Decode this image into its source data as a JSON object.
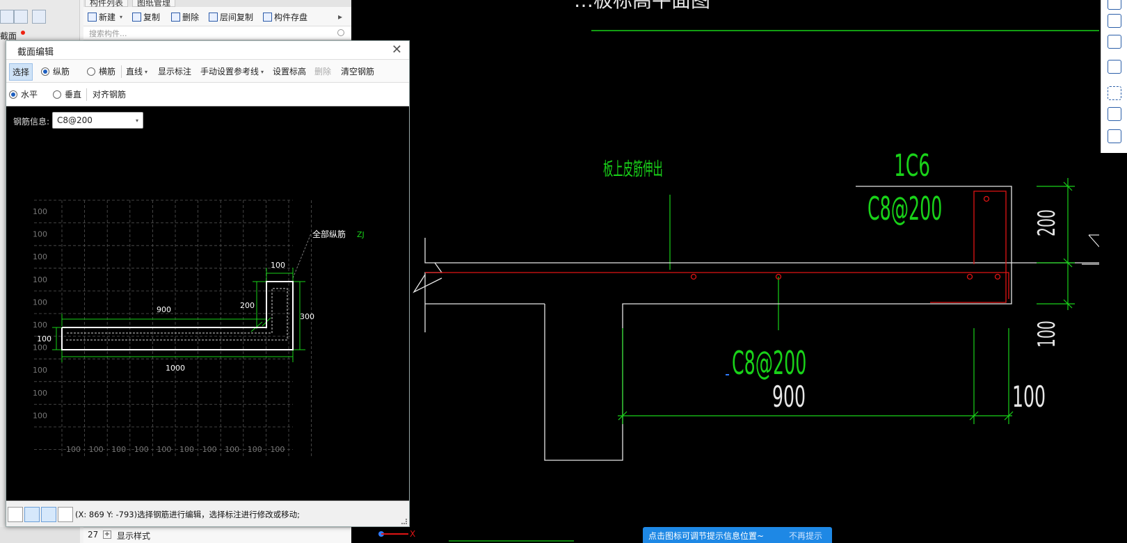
{
  "app": {
    "tabs": [
      "构件列表",
      "图纸管理"
    ],
    "toolbar": {
      "new": "新建",
      "copy": "复制",
      "delete": "删除",
      "floor_copy": "层间复制",
      "save_component": "构件存盘"
    },
    "search_placeholder": "搜索构件...",
    "left_label": "截面",
    "list_row": {
      "num": "27",
      "label": "显示样式"
    }
  },
  "cad": {
    "title_partial": "…板标高平面图",
    "note_board": "板上皮筋伸出",
    "label_1c6": "1C6",
    "label_c8_top": "C8@200",
    "label_c8_bottom": "C8@200",
    "dim_900": "900",
    "dim_100_bottom": "100",
    "dim_200_right": "200",
    "dim_100_right": "100",
    "colors": {
      "green": "#19d219",
      "red": "#e01414",
      "white": "#e6e6e6"
    }
  },
  "tip": {
    "text": "点击图标可调节提示信息位置~",
    "dismiss": "不再提示"
  },
  "dialog": {
    "title": "截面编辑",
    "close_icon": "close-icon",
    "toolbar1": {
      "select": "选择",
      "longitudinal": "纵筋",
      "transverse": "横筋",
      "line": "直线",
      "show_dim": "显示标注",
      "manual_ref": "手动设置参考线",
      "set_elevation": "设置标高",
      "delete": "删除",
      "clear": "清空钢筋"
    },
    "toolbar2": {
      "horizontal": "水平",
      "vertical": "垂直",
      "align": "对齐钢筋"
    },
    "rebar_info_label": "钢筋信息:",
    "rebar_info_value": "C8@200",
    "section": {
      "grid_label": "100",
      "all_longitudinal": "全部纵筋",
      "zj": "ZJ",
      "dim_top": "100",
      "dim_900": "900",
      "dim_200": "200",
      "dim_300": "300",
      "dim_left": "100",
      "dim_1000": "1000"
    },
    "status_text": "(X: 869 Y: -793)选择钢筋进行编辑，选择标注进行修改或移动;"
  }
}
